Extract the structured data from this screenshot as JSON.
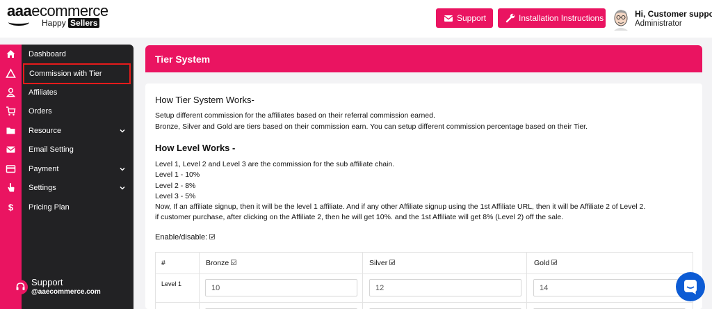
{
  "brand": {
    "name_bold": "aaa",
    "name_rest": "ecommerce",
    "tagline_a": "Happy",
    "tagline_b": "Sellers"
  },
  "header": {
    "support_label": "Support",
    "install_label": "Installation Instructions",
    "user_greeting": "Hi, Customer support",
    "user_role": "Administrator"
  },
  "sidebar": {
    "items": [
      {
        "label": "Dashboard",
        "icon": "home-icon"
      },
      {
        "label": "Commission with Tier",
        "icon": "triangle-icon",
        "active": true
      },
      {
        "label": "Affiliates",
        "icon": "user-icon"
      },
      {
        "label": "Orders",
        "icon": "cart-icon"
      },
      {
        "label": "Resource",
        "icon": "folder-icon",
        "expandable": true
      },
      {
        "label": "Email Setting",
        "icon": "mail-icon"
      },
      {
        "label": "Payment",
        "icon": "credit-card-icon",
        "expandable": true
      },
      {
        "label": "Settings",
        "icon": "hand-pointer-icon",
        "expandable": true
      },
      {
        "label": "Pricing Plan",
        "icon": "dollar-icon"
      }
    ],
    "support_title": "Support",
    "support_email": "@aaecommerce.com"
  },
  "page": {
    "banner_title": "Tier System",
    "tier_heading": "How Tier System Works-",
    "tier_text_1": "Setup different commission for the affiliates based on their referral commission earned.",
    "tier_text_2": "Bronze, Silver and Gold are tiers based on their commission earn. You can setup different commission percentage based on their Tier.",
    "level_heading": "How Level Works -",
    "level_lines": [
      "Level 1, Level 2 and Level 3 are the commission for the sub affiliate chain.",
      "Level 1 - 10%",
      "Level 2 - 8%",
      "Level 3 - 5%",
      "Now, If an affiliate signup, then it will be the level 1 affiliate. And if any other Affiliate signup using the 1st Affiliate URL, then it will be Affiliate 2 of Level 2.",
      "if customer purchase, after clicking on the Affiliate 2, then he will get 10%. and the 1st Affiliate will get 8% (Level 2) off the sale."
    ],
    "enable_label": "Enable/disable:",
    "enable_checked": true
  },
  "table": {
    "headers": [
      "#",
      "Bronze",
      "Silver",
      "Gold"
    ],
    "rows": [
      {
        "label": "Level 1",
        "values": [
          "10",
          "12",
          "14"
        ]
      }
    ]
  },
  "colors": {
    "accent": "#ea1461",
    "sidebar": "#222224",
    "chat": "#0c5bd4"
  }
}
